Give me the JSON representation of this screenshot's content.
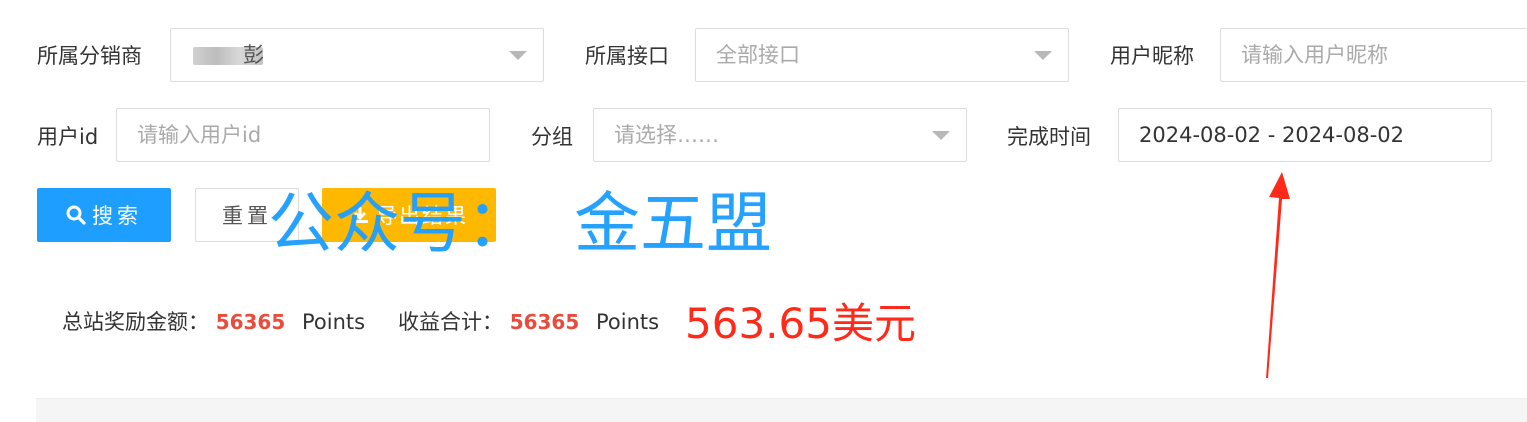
{
  "filters": {
    "distributor": {
      "label": "所属分销商",
      "value": "彭"
    },
    "interface": {
      "label": "所属接口",
      "value": "全部接口"
    },
    "nickname": {
      "label": "用户昵称",
      "placeholder": "请输入用户昵称"
    },
    "userid": {
      "label": "用户id",
      "placeholder": "请输入用户id"
    },
    "group": {
      "label": "分组",
      "value": "请选择……"
    },
    "completed_time": {
      "label": "完成时间",
      "value": "2024-08-02 - 2024-08-02"
    }
  },
  "buttons": {
    "search": "搜索",
    "reset": "重置",
    "export": "导出结果"
  },
  "stats": {
    "total_reward_label": "总站奖励金额：",
    "total_reward_value": "56365",
    "total_reward_unit": "Points",
    "income_label": "收益合计：",
    "income_value": "56365",
    "income_unit": "Points"
  },
  "annotations": {
    "usd": "563.65美元",
    "watermark": "公众号：  金五盟"
  },
  "colors": {
    "primary": "#1E9FFF",
    "warning": "#FFB800",
    "danger": "#e74c3c",
    "annotation_red": "#ff2a1a"
  }
}
